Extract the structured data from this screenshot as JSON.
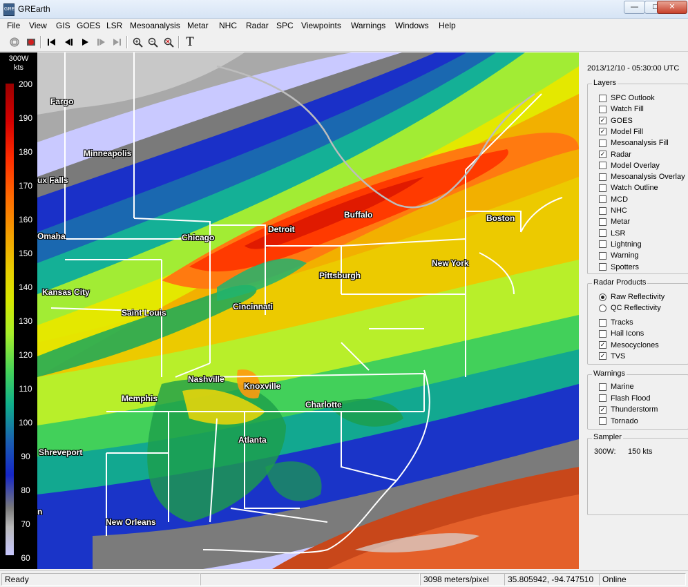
{
  "window": {
    "title": "GREarth",
    "app_icon_text": "GRE"
  },
  "menu": [
    "File",
    "View",
    "GIS",
    "GOES",
    "LSR",
    "Mesoanalysis",
    "Metar",
    "NHC",
    "Radar",
    "SPC",
    "Viewpoints",
    "Warnings",
    "Windows",
    "Help"
  ],
  "colorbar": {
    "title_line1": "300W",
    "title_line2": "kts",
    "labels": [
      "200",
      "190",
      "180",
      "170",
      "160",
      "150",
      "140",
      "130",
      "120",
      "110",
      "100",
      "90",
      "80",
      "70",
      "60"
    ]
  },
  "map": {
    "cities": [
      "Fargo",
      "Minneapolis",
      "ux Falls",
      "Omaha",
      "Kansas City",
      "Saint Louis",
      "Chicago",
      "Detroit",
      "Buffalo",
      "Boston",
      "Pittsburgh",
      "New York",
      "Cincinnati",
      "Nashville",
      "Knoxville",
      "Memphis",
      "Charlotte",
      "Atlanta",
      "Shreveport",
      "New Orleans",
      "n"
    ]
  },
  "panel": {
    "timestamp": "2013/12/10 - 05:30:00 UTC",
    "layers_title": "Layers",
    "layers": [
      {
        "label": "SPC Outlook",
        "checked": false
      },
      {
        "label": "Watch Fill",
        "checked": false
      },
      {
        "label": "GOES",
        "checked": true
      },
      {
        "label": "Model Fill",
        "checked": true
      },
      {
        "label": "Mesoanalysis Fill",
        "checked": false
      },
      {
        "label": "Radar",
        "checked": true
      },
      {
        "label": "Model Overlay",
        "checked": false
      },
      {
        "label": "Mesoanalysis Overlay",
        "checked": false
      },
      {
        "label": "Watch Outline",
        "checked": false
      },
      {
        "label": "MCD",
        "checked": false
      },
      {
        "label": "NHC",
        "checked": false
      },
      {
        "label": "Metar",
        "checked": false
      },
      {
        "label": "LSR",
        "checked": false
      },
      {
        "label": "Lightning",
        "checked": false
      },
      {
        "label": "Warning",
        "checked": false
      },
      {
        "label": "Spotters",
        "checked": false
      }
    ],
    "radar_title": "Radar Products",
    "radar_radios": [
      {
        "label": "Raw Reflectivity",
        "selected": true
      },
      {
        "label": "QC Reflectivity",
        "selected": false
      }
    ],
    "radar_checks": [
      {
        "label": "Tracks",
        "checked": false
      },
      {
        "label": "Hail Icons",
        "checked": false
      },
      {
        "label": "Mesocyclones",
        "checked": true
      },
      {
        "label": "TVS",
        "checked": true
      }
    ],
    "warnings_title": "Warnings",
    "warnings": [
      {
        "label": "Marine",
        "checked": false
      },
      {
        "label": "Flash Flood",
        "checked": false
      },
      {
        "label": "Thunderstorm",
        "checked": true
      },
      {
        "label": "Tornado",
        "checked": false
      }
    ],
    "sampler_title": "Sampler",
    "sampler_key": "300W:",
    "sampler_value": "150 kts"
  },
  "status": {
    "ready": "Ready",
    "scale": "3098 meters/pixel",
    "coords": "35.805942, -94.747510",
    "online": "Online"
  }
}
